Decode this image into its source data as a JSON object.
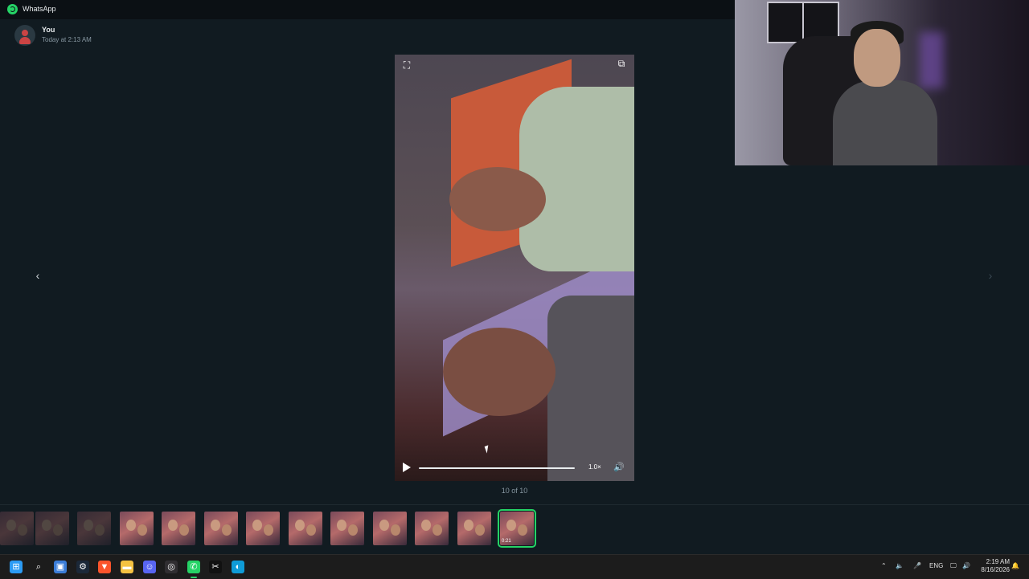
{
  "app": {
    "title": "WhatsApp",
    "accent": "#25d366"
  },
  "message": {
    "sender": "You",
    "timestamp": "Today at 2:13 AM"
  },
  "viewer": {
    "counter": "10 of 10",
    "speed": "1.0×",
    "progress": 0
  },
  "thumbnails": [
    {
      "faded": true,
      "duration": ""
    },
    {
      "faded": true,
      "duration": ""
    },
    {
      "faded": true,
      "duration": ""
    },
    {
      "faded": false,
      "duration": ""
    },
    {
      "faded": false,
      "duration": ""
    },
    {
      "faded": false,
      "duration": ""
    },
    {
      "faded": false,
      "duration": ""
    },
    {
      "faded": false,
      "duration": ""
    },
    {
      "faded": false,
      "duration": ""
    },
    {
      "faded": false,
      "duration": ""
    },
    {
      "faded": false,
      "duration": ""
    },
    {
      "faded": false,
      "duration": ""
    },
    {
      "faded": false,
      "duration": "0:21",
      "active": true
    }
  ],
  "taskbar": {
    "icons": [
      "windows-start-icon",
      "search-icon",
      "file-explorer-icon",
      "steam-icon",
      "brave-browser-icon",
      "folder-icon",
      "discord-icon",
      "obs-icon",
      "whatsapp-icon",
      "capcut-icon",
      "edge-icon"
    ],
    "tray": {
      "language": "ENG",
      "time": "2:19 AM",
      "date": "8/16/2026"
    }
  }
}
